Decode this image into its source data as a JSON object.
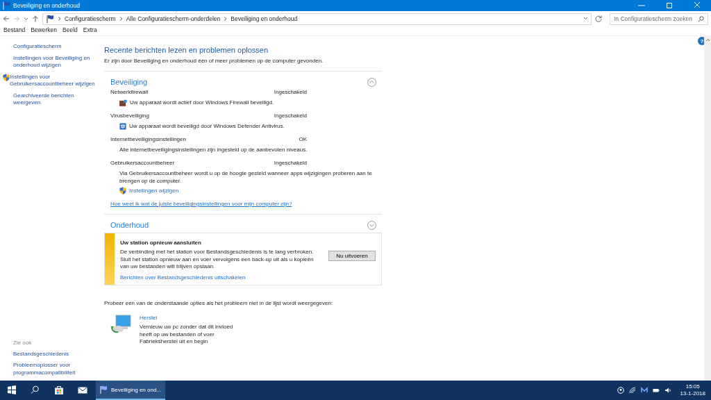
{
  "window": {
    "title": "Beveiliging en onderhoud"
  },
  "address_bar": {
    "breadcrumb": [
      "Configuratiescherm",
      "Alle Configuratiescherm-onderdelen",
      "Beveiliging en onderhoud"
    ]
  },
  "search": {
    "placeholder": "In Configuratiescherm zoeken"
  },
  "menu": [
    "Bestand",
    "Bewerken",
    "Beeld",
    "Extra"
  ],
  "sidebar": {
    "links": [
      {
        "label": "Configuratiescherm",
        "kind": "plain"
      },
      {
        "label": "Instellingen voor Beveiliging en onderhoud wijzigen",
        "kind": "plain"
      },
      {
        "label": "Instellingen voor Gebruikersaccountbeheer wijzigen",
        "kind": "shield"
      },
      {
        "label": "Gearchiveerde berichten weergeven",
        "kind": "plain"
      }
    ],
    "see_also": {
      "heading": "Zie ook",
      "links": [
        "Bestandsgeschiedenis",
        "Probleemoplosser voor programmacompatibiliteit"
      ]
    }
  },
  "main": {
    "heading": "Recente berichten lezen en problemen oplossen",
    "intro": "Er zijn door Beveiliging en onderhoud één of meer problemen op de computer gevonden.",
    "help": "?",
    "sections": [
      {
        "title": "Beveiliging",
        "expanded": true,
        "items": [
          {
            "name": "Netwerkfirewall",
            "status": "Ingeschakeld",
            "kind": "firewall",
            "text": "Uw apparaat wordt actief door Windows Firewall beveiligd."
          },
          {
            "name": "Virusbeveiliging",
            "status": "Ingeschakeld",
            "kind": "defender",
            "text": "Uw apparaat wordt beveiligd door Windows Defender Antivirus."
          },
          {
            "name": "Internetbeveiligingsinstellingen",
            "status": "OK",
            "kind": "plain",
            "text": "Alle internetbeveiligingsinstellingen zijn ingesteld op de aanbevolen niveaus."
          },
          {
            "name": "Gebruikersaccountbeheer",
            "status": "Ingeschakeld",
            "kind": "plain",
            "text": "Via Gebruikersaccountbeheer wordt u op de hoogte gesteld wanneer apps wijzigingen proberen aan te brengen op de computer.",
            "link": "Instellingen wijzigen"
          }
        ],
        "footer_link": "Hoe weet ik wat de juiste beveiligingsinstellingen voor mijn computer zijn?"
      },
      {
        "title": "Onderhoud",
        "expanded": false,
        "alert": {
          "title": "Uw station opnieuw aansluiten",
          "text": "De verbinding met het station voor Bestandsgeschiedenis is te lang verbroken. Sluit het station opnieuw aan en voer vervolgens een back-up uit als u kopieën van uw bestanden wilt blijven opslaan.",
          "button": "Nu uitvoeren",
          "link": "Berichten over Bestandsgeschiedenis uitschakelen"
        }
      }
    ],
    "alternatives": {
      "intro": "Probeer een van de onderstaande opties als het probleem niet in de lijst wordt weergegeven:",
      "items": [
        {
          "title": "Herstel",
          "text": "Vernieuw uw pc zonder dat dit invloed heeft op uw bestanden of voer Fabrieksherstel uit en begin"
        }
      ]
    }
  },
  "taskbar": {
    "active_app": "Beveiliging en ond...",
    "time": "15:05",
    "date": "13-1-2018"
  }
}
